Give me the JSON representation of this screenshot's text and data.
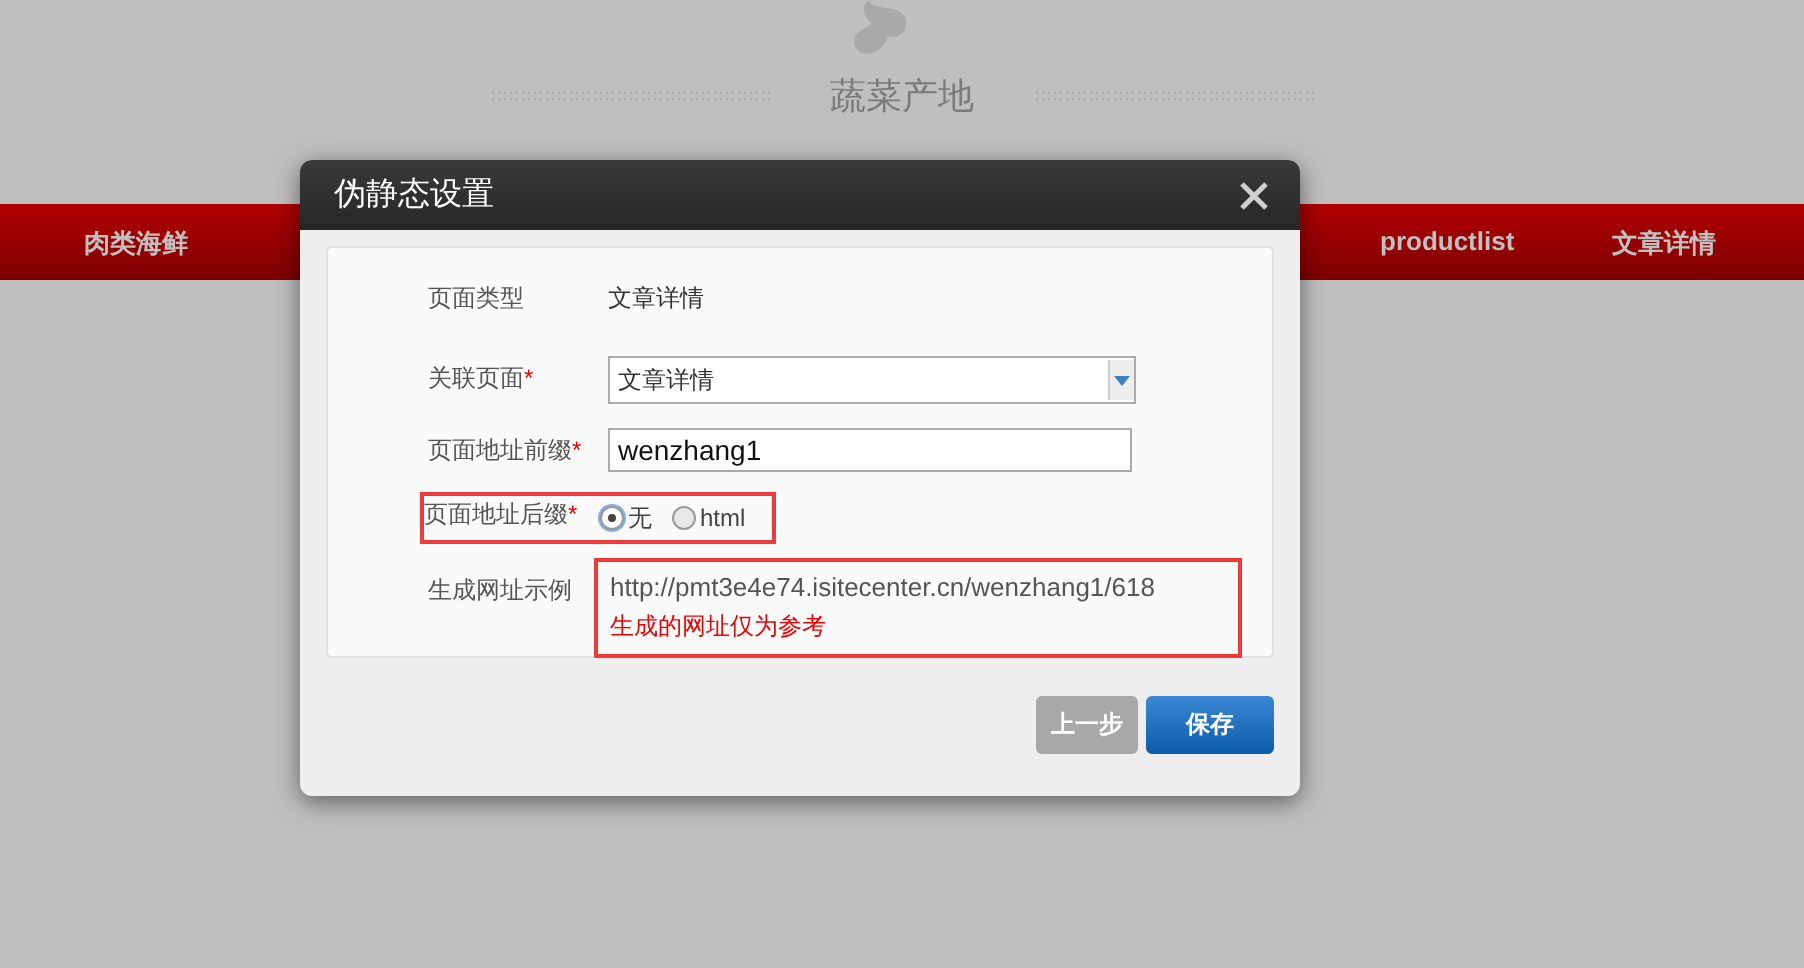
{
  "site": {
    "category_title": "蔬菜产地"
  },
  "nav": {
    "items": [
      {
        "label": "肉类海鲜"
      },
      {
        "label": "productlist"
      },
      {
        "label": "文章详情"
      }
    ]
  },
  "dialog": {
    "title": "伪静态设置",
    "fields": [
      {
        "kind": "text",
        "label": "页面类型",
        "value": "文章详情"
      },
      {
        "kind": "select",
        "label": "关联页面",
        "required_mark": "*",
        "value": "文章详情"
      },
      {
        "kind": "input",
        "label": "页面地址前缀",
        "required_mark": "*",
        "value": "wenzhang1"
      },
      {
        "kind": "radio",
        "label": "页面地址后缀",
        "required_mark": "*",
        "highlighted": true,
        "options": [
          {
            "label": "无",
            "selected": true
          },
          {
            "label": "html",
            "selected": false
          }
        ]
      },
      {
        "kind": "url",
        "label": "生成网址示例",
        "highlighted": true,
        "value": "http://pmt3e4e74.isitecenter.cn/wenzhang1/618",
        "note": "生成的网址仅为参考"
      }
    ],
    "buttons": [
      {
        "label": "上一步",
        "kind": "secondary",
        "disabled": true
      },
      {
        "label": "保存",
        "kind": "primary",
        "disabled": false
      }
    ]
  }
}
